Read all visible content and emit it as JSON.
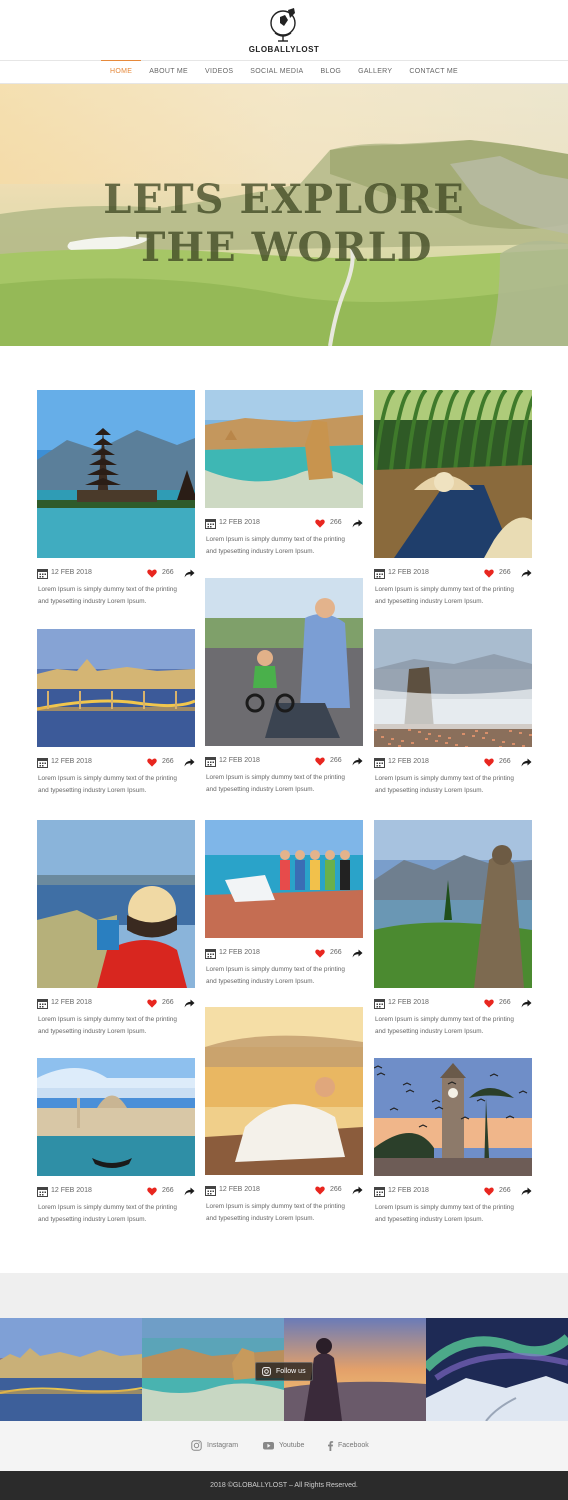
{
  "brand": {
    "name": "GLOBALLYLOST"
  },
  "nav": {
    "items": [
      "HOME",
      "ABOUT ME",
      "VIDEOS",
      "SOCIAL MEDIA",
      "BLOG",
      "GALLERY",
      "CONTACT ME"
    ],
    "active": "HOME"
  },
  "hero": {
    "line1": "LETS EXPLORE",
    "line2": "THE WORLD"
  },
  "posts": [
    {
      "image": "bali-temple",
      "date": "12 FEB 2018",
      "likes": "266",
      "text_line1": "Lorem Ipsum is simply dummy text of the printing",
      "text_line2": "and typesetting industry Lorem Ipsum."
    },
    {
      "image": "twelve-apostles",
      "date": "12 FEB 2018",
      "likes": "266",
      "text_line1": "Lorem Ipsum is simply dummy text of the printing",
      "text_line2": "and typesetting industry Lorem Ipsum."
    },
    {
      "image": "mekong-boat",
      "date": "12 FEB 2018",
      "likes": "266",
      "text_line1": "Lorem Ipsum is simply dummy text of the printing",
      "text_line2": "and typesetting industry Lorem Ipsum."
    },
    {
      "image": "budapest-bridge",
      "date": "12 FEB 2018",
      "likes": "266",
      "text_line1": "Lorem Ipsum is simply dummy text of the printing",
      "text_line2": "and typesetting industry Lorem Ipsum."
    },
    {
      "image": "father-son-bike",
      "date": "12 FEB 2018",
      "likes": "266",
      "text_line1": "Lorem Ipsum is simply dummy text of the printing",
      "text_line2": "and typesetting industry Lorem Ipsum."
    },
    {
      "image": "meteora-rock",
      "date": "12 FEB 2018",
      "likes": "266",
      "text_line1": "Lorem Ipsum is simply dummy text of the printing",
      "text_line2": "and typesetting industry Lorem Ipsum."
    },
    {
      "image": "woman-hat-sea",
      "date": "12 FEB 2018",
      "likes": "266",
      "text_line1": "Lorem Ipsum is simply dummy text of the printing",
      "text_line2": "and typesetting industry Lorem Ipsum."
    },
    {
      "image": "family-pier",
      "date": "12 FEB 2018",
      "likes": "266",
      "text_line1": "Lorem Ipsum is simply dummy text of the printing",
      "text_line2": "and typesetting industry Lorem Ipsum."
    },
    {
      "image": "lake-statue",
      "date": "12 FEB 2018",
      "likes": "266",
      "text_line1": "Lorem Ipsum is simply dummy text of the printing",
      "text_line2": "and typesetting industry Lorem Ipsum."
    },
    {
      "image": "venice-gondola",
      "date": "12 FEB 2018",
      "likes": "266",
      "text_line1": "Lorem Ipsum is simply dummy text of the printing",
      "text_line2": "and typesetting industry Lorem Ipsum."
    },
    {
      "image": "couple-sunset",
      "date": "12 FEB 2018",
      "likes": "266",
      "text_line1": "Lorem Ipsum is simply dummy text of the printing",
      "text_line2": "and typesetting industry Lorem Ipsum."
    },
    {
      "image": "clock-tower",
      "date": "12 FEB 2018",
      "likes": "266",
      "text_line1": "Lorem Ipsum is simply dummy text of the printing",
      "text_line2": "and typesetting industry Lorem Ipsum."
    }
  ],
  "instagram": {
    "follow_label": "Follow us"
  },
  "social": {
    "instagram": "Instagram",
    "youtube": "Youtube",
    "facebook": "Facebook"
  },
  "footer": {
    "copyright": "2018 ©GLOBALLYLOST – All Rights Reserved."
  },
  "colors": {
    "accent": "#e6893b",
    "heart": "#e8261f",
    "footer_bg": "#2b2b2b"
  }
}
